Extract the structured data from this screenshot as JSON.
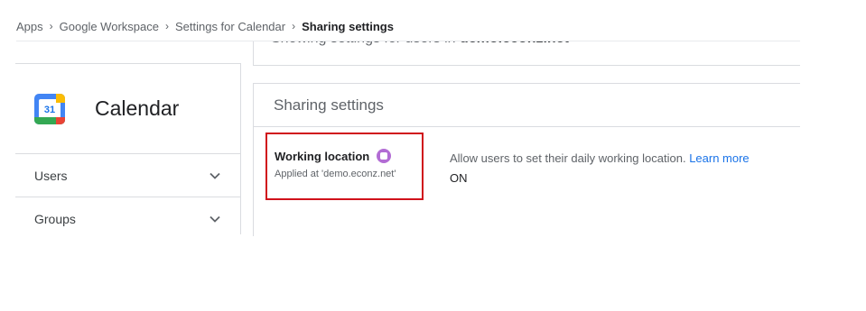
{
  "breadcrumb": {
    "items": [
      "Apps",
      "Google Workspace",
      "Settings for Calendar"
    ],
    "current": "Sharing settings",
    "separator": "›"
  },
  "top_card": {
    "partial_text_prefix": "Showing settings for users in ",
    "partial_text_domain": "demo.econz.net"
  },
  "app": {
    "name": "Calendar",
    "icon": "google-calendar-icon",
    "icon_day": "31"
  },
  "sidebar": {
    "items": [
      {
        "label": "Users",
        "icon": "chevron-down-icon"
      },
      {
        "label": "Groups",
        "icon": "chevron-down-icon"
      }
    ]
  },
  "sharing": {
    "header": "Sharing settings",
    "setting": {
      "name": "Working location",
      "badge_icon": "beta-badge-icon",
      "applied_at": "Applied at 'demo.econz.net'",
      "description": "Allow users to set their daily working location.",
      "learn_more": "Learn more",
      "value": "ON"
    }
  },
  "colors": {
    "highlight": "#d0121b",
    "link": "#1a73e8",
    "badge": "#b26cd4"
  }
}
